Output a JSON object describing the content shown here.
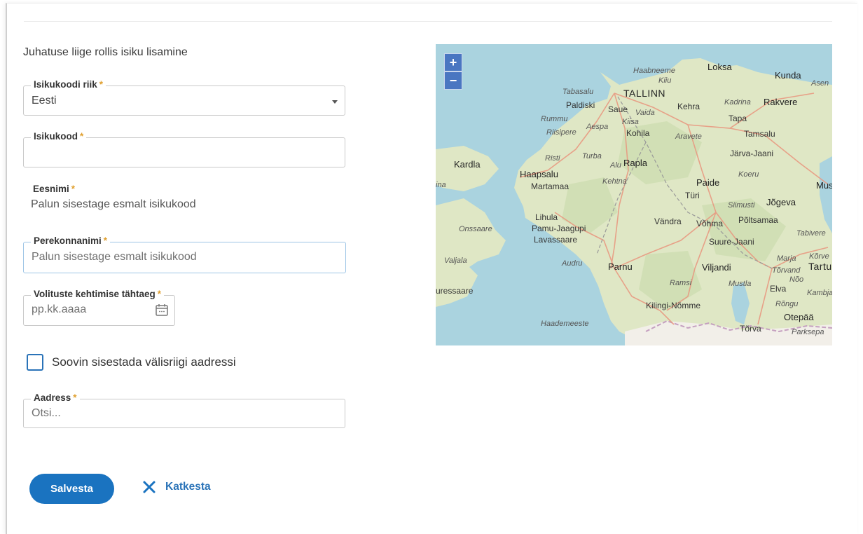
{
  "form": {
    "title": "Juhatuse liige rollis isiku lisamine",
    "country_field": {
      "label": "Isikukoodi riik",
      "value": "Eesti"
    },
    "id_field": {
      "label": "Isikukood",
      "value": ""
    },
    "first_name": {
      "label": "Eesnimi",
      "value": "Palun sisestage esmalt isikukood"
    },
    "last_name": {
      "label": "Perekonnanimi",
      "value": "Palun sisestage esmalt isikukood"
    },
    "validity_date": {
      "label": "Volituste kehtimise tähtaeg",
      "placeholder": "pp.kk.aaaa"
    },
    "foreign_address_checkbox": {
      "label": "Soovin sisestada välisriigi aadressi",
      "checked": false
    },
    "address": {
      "label": "Aadress",
      "placeholder": "Otsi..."
    },
    "required_marker": "*"
  },
  "actions": {
    "save_label": "Salvesta",
    "cancel_label": "Katkesta"
  },
  "map": {
    "zoom_in": "+",
    "zoom_out": "−",
    "places": {
      "loksa": "Loksa",
      "haabneeme": "Haabneeme",
      "kiiu": "Kiiu",
      "kunda": "Kunda",
      "asen": "Asen",
      "tabasalu": "Tabasalu",
      "tallinn": "TALLINN",
      "paldiski": "Paldiski",
      "saue": "Saue",
      "vaida": "Vaida",
      "kehra": "Kehra",
      "kadrina": "Kadrina",
      "rakvere": "Rakvere",
      "rummu": "Rummu",
      "aespa": "Aespa",
      "kiisa": "Kiisa",
      "tapa": "Tapa",
      "riisipere": "Riisipere",
      "kohila": "Kohila",
      "aravete": "Aravete",
      "tamsalu": "Tamsalu",
      "risti": "Risti",
      "turba": "Turba",
      "jarva_jaani": "Järva-Jaani",
      "kardla": "Kardla",
      "alu": "Alu",
      "rapla": "Rapla",
      "haapsalu": "Haapsalu",
      "koeru": "Koeru",
      "ina": "ina",
      "kehtna": "Kehtna",
      "paide": "Paide",
      "martamaa": "Martamaa",
      "mus": "Mus",
      "turi": "Türi",
      "siimusti": "Siimusti",
      "jogeva": "Jõgeva",
      "lihula": "Lihula",
      "vandra": "Vändra",
      "vohma": "Võhma",
      "poltsamaa": "Põltsamaa",
      "onssaare": "Onssaare",
      "pamu_jaagupi": "Pamu-Jaagupi",
      "tabivere": "Tabivere",
      "lavassaare": "Lavassaare",
      "suure_jaani": "Suure-Jaani",
      "valjala": "Valjala",
      "audru": "Audru",
      "parnu": "Parnu",
      "viljandi": "Viljandi",
      "marja": "Marja",
      "korve": "Kõrve",
      "tartu": "Tartu",
      "torvand": "Tõrvand",
      "noo": "Nõo",
      "uressaare": "uressaare",
      "ramsi": "Ramsi",
      "mustla": "Mustla",
      "elva": "Elva",
      "kambja": "Kambja",
      "rongu": "Rõngu",
      "kilingi_nomme": "Kilingi-Nõmme",
      "otepaa": "Otepää",
      "haademeeste": "Haademeeste",
      "torva": "Tõrva",
      "parksepa": "Parksepa"
    }
  },
  "colors": {
    "primary": "#1a73c0",
    "required": "#e0a030",
    "water": "#aad3df",
    "land": "#dfe7c5"
  }
}
